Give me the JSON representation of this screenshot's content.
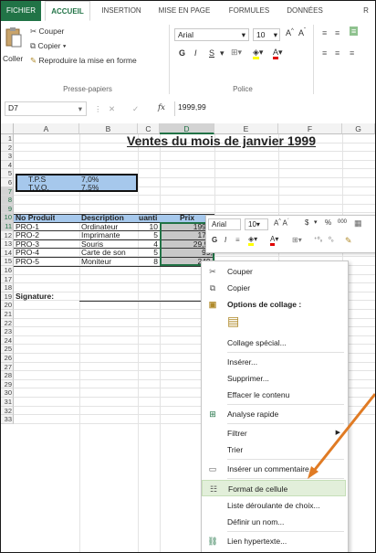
{
  "ribbon": {
    "tabs": [
      "FICHIER",
      "ACCUEIL",
      "INSERTION",
      "MISE EN PAGE",
      "FORMULES",
      "DONNÉES",
      "R"
    ],
    "clipboard": {
      "paste": "Coller",
      "cut": "Couper",
      "copy": "Copier",
      "format_painter": "Reproduire la mise en forme",
      "group_label": "Presse-papiers"
    },
    "font": {
      "name": "Arial",
      "size": "10",
      "group_label": "Police",
      "bold": "G",
      "italic": "I",
      "underline": "S"
    }
  },
  "formula_bar": {
    "name_box": "D7",
    "fx": "fx",
    "value": "1999,99"
  },
  "columns": [
    "A",
    "B",
    "C",
    "D",
    "E",
    "F",
    "G"
  ],
  "rows": [
    "1",
    "2",
    "3",
    "4",
    "5",
    "6",
    "7",
    "8",
    "9",
    "10",
    "11",
    "12",
    "13",
    "14",
    "15",
    "16",
    "17",
    "18",
    "19",
    "20",
    "21",
    "22",
    "23",
    "24",
    "25",
    "26",
    "27",
    "28",
    "29",
    "30",
    "31",
    "32",
    "33"
  ],
  "sheet": {
    "title": "Ventes du mois de janvier 1999",
    "tps_label": "T.P.S",
    "tps_value": "7,0%",
    "tvq_label": "T.V.Q.",
    "tvq_value": "7,5%",
    "headers": [
      "No Produit",
      "Description",
      "uanti",
      "Prix"
    ],
    "products": [
      {
        "no": "PRO-1",
        "desc": "Ordinateur",
        "qty": "10",
        "price": "1999,"
      },
      {
        "no": "PRO-2",
        "desc": "Imprimante",
        "qty": "5",
        "price": "177,"
      },
      {
        "no": "PRO-3",
        "desc": "Souris",
        "qty": "4",
        "price": "29,99"
      },
      {
        "no": "PRO-4",
        "desc": "Carte de son",
        "qty": "5",
        "price": "99,"
      },
      {
        "no": "PRO-5",
        "desc": "Moniteur",
        "qty": "8",
        "price": "249,"
      }
    ],
    "signature": "Signature:"
  },
  "mini_toolbar": {
    "font": "Arial",
    "size": "10",
    "bold": "G",
    "italic": "I",
    "currency": "$",
    "percent": "%",
    "thousands": "000"
  },
  "context_menu": {
    "items": [
      {
        "label": "Couper",
        "icon": "scissors-icon"
      },
      {
        "label": "Copier",
        "icon": "copy-icon"
      },
      {
        "label": "Options de collage :",
        "icon": "paste-icon"
      },
      {
        "label": "",
        "icon": "paste-option-icon"
      },
      {
        "label": "Collage spécial...",
        "icon": ""
      },
      {
        "label": "Insérer...",
        "icon": ""
      },
      {
        "label": "Supprimer...",
        "icon": ""
      },
      {
        "label": "Effacer le contenu",
        "icon": ""
      },
      {
        "label": "Analyse rapide",
        "icon": "quick-analysis-icon"
      },
      {
        "label": "Filtrer",
        "icon": ""
      },
      {
        "label": "Trier",
        "icon": ""
      },
      {
        "label": "Insérer un commentaire",
        "icon": "comment-icon"
      },
      {
        "label": "Format de cellule",
        "icon": "format-cells-icon"
      },
      {
        "label": "Liste déroulante de choix...",
        "icon": ""
      },
      {
        "label": "Définir un nom...",
        "icon": ""
      },
      {
        "label": "Lien hypertexte...",
        "icon": "hyperlink-icon"
      }
    ],
    "highlighted": "Format de cellule"
  },
  "colors": {
    "excel_green": "#217346",
    "annotation_arrow": "#e07b24",
    "highlight_bg": "#e2efda",
    "cell_blue": "#a6c8ec",
    "price_gray": "#c8c8c8"
  }
}
